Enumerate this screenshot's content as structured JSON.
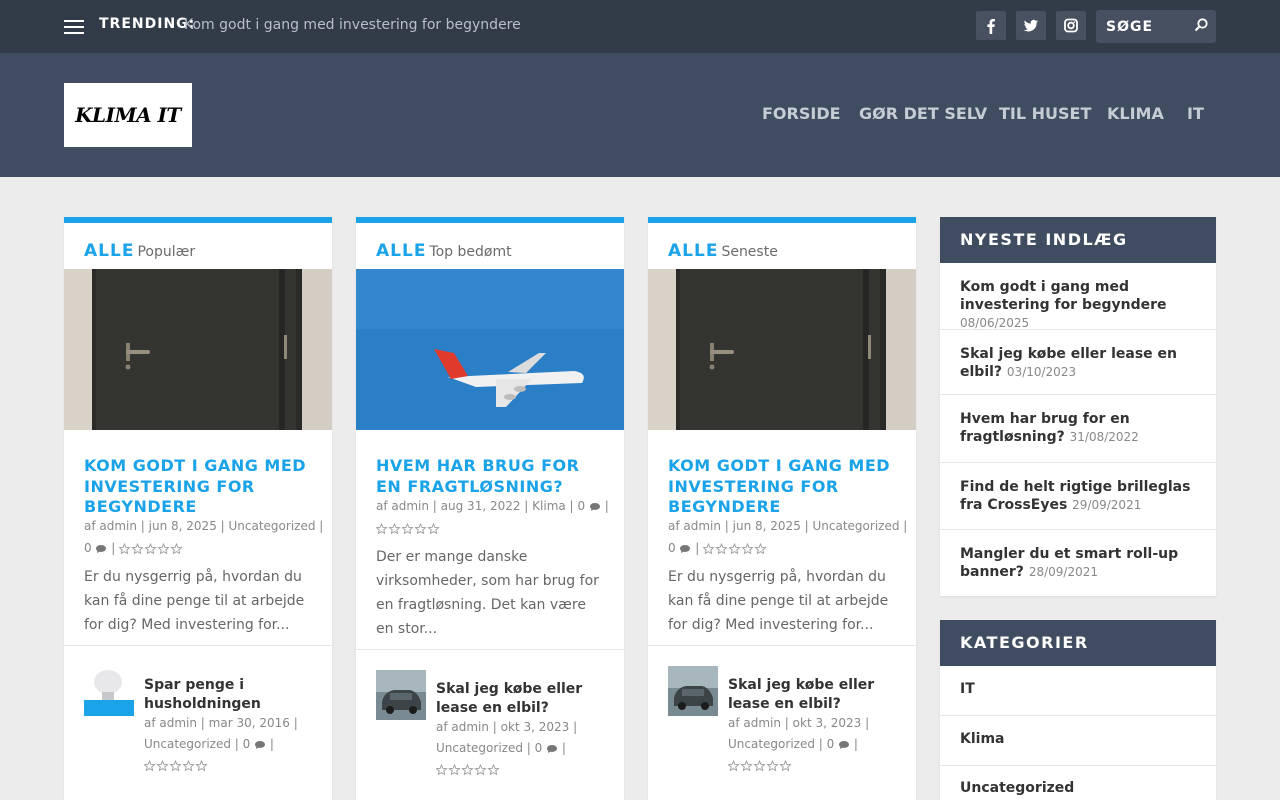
{
  "topbar": {
    "trending_label": "TRENDING:",
    "trending_link": "Kom godt i gang med investering for begyndere",
    "social": [
      "facebook-icon",
      "twitter-icon",
      "instagram-icon"
    ],
    "search_placeholder": "SØGE"
  },
  "header": {
    "logo_text": "KLIMA IT",
    "nav": [
      "FORSIDE",
      "GØR DET SELV",
      "TIL HUSET",
      "KLIMA",
      "IT"
    ]
  },
  "colors": {
    "accent": "#1aa3e8",
    "topbar": "#323b48",
    "header": "#404d60",
    "background": "#ececec"
  },
  "columns": [
    {
      "filter": "ALLE",
      "subtitle": "Populær",
      "image": "door",
      "title": "KOM GODT I GANG MED INVESTERING FOR BEGYNDERE",
      "meta_line1": "af admin | jun 8, 2025 | Uncategorized |",
      "comments": "0",
      "excerpt": "Er du nysgerrig på, hvordan du kan få dine penge til at arbejde for dig? Med investering for...",
      "small": {
        "image": "bulb",
        "title": "Spar penge i husholdningen",
        "meta_line1": "af admin | mar 30, 2016 |",
        "meta_line2": "Uncategorized |",
        "comments": "0"
      }
    },
    {
      "filter": "ALLE",
      "subtitle": "Top bedømt",
      "image": "airplane",
      "title": "HVEM HAR BRUG FOR EN FRAGTLØSNING?",
      "meta_line1": "af admin | aug 31, 2022 | Klima |",
      "comments": "0",
      "excerpt": "Der er mange danske virksomheder, som har brug for en fragtløsning. Det kan være en stor...",
      "small": {
        "image": "car",
        "title": "Skal jeg købe eller lease en elbil?",
        "meta_line1": "af admin | okt 3, 2023 |",
        "meta_line2": "Uncategorized |",
        "comments": "0"
      }
    },
    {
      "filter": "ALLE",
      "subtitle": "Seneste",
      "image": "door",
      "title": "KOM GODT I GANG MED INVESTERING FOR BEGYNDERE",
      "meta_line1": "af admin | jun 8, 2025 | Uncategorized |",
      "comments": "0",
      "excerpt": "Er du nysgerrig på, hvordan du kan få dine penge til at arbejde for dig? Med investering for...",
      "small": {
        "image": "car",
        "title": "Skal jeg købe eller lease en elbil?",
        "meta_line1": "af admin | okt 3, 2023 |",
        "meta_line2": "Uncategorized |",
        "comments": "0"
      }
    }
  ],
  "sidebar": {
    "recent_title": "NYESTE INDLÆG",
    "recent": [
      {
        "title": "Kom godt i gang med investering for begyndere",
        "date": "08/06/2025"
      },
      {
        "title": "Skal jeg købe eller lease en elbil?",
        "date": "03/10/2023"
      },
      {
        "title": "Hvem har brug for en fragtløsning?",
        "date": "31/08/2022"
      },
      {
        "title": "Find de helt rigtige brilleglas fra CrossEyes",
        "date": "29/09/2021"
      },
      {
        "title": "Mangler du et smart roll-up banner?",
        "date": "28/09/2021"
      }
    ],
    "categories_title": "KATEGORIER",
    "categories": [
      "IT",
      "Klima",
      "Uncategorized"
    ]
  }
}
